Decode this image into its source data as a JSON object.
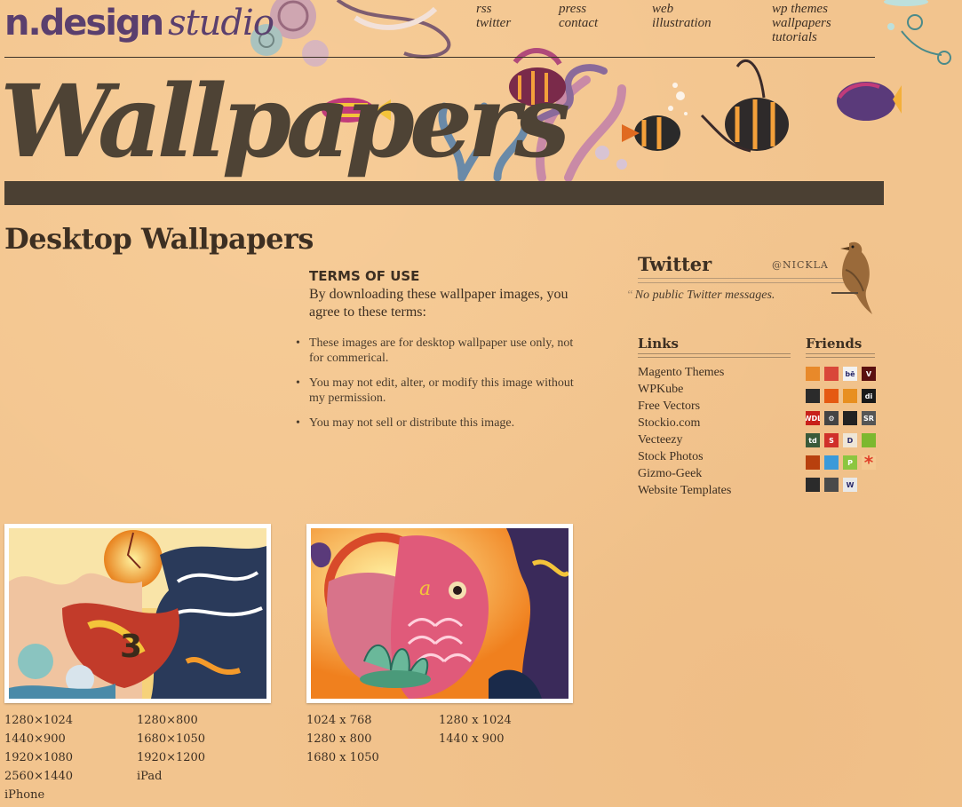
{
  "header": {
    "logo_bold": "n.design",
    "logo_italic": "studio",
    "nav": [
      [
        "rss",
        "twitter"
      ],
      [
        "press",
        "contact"
      ],
      [
        "web",
        "illustration"
      ],
      [
        "wp themes",
        "wallpapers",
        "tutorials"
      ]
    ],
    "banner_title": "Wallpapers"
  },
  "page_title": "Desktop Wallpapers",
  "terms": {
    "heading": "TERMS OF USE",
    "intro": "By downloading these wallpaper images, you agree to these terms:",
    "items": [
      "These images are for desktop wallpaper use only, not for commerical.",
      "You may not edit, alter, or modify this image without my permission.",
      "You may not sell or distribute this image."
    ]
  },
  "twitter": {
    "title": "Twitter",
    "handle": "@NICKLA",
    "message": "No public Twitter messages."
  },
  "links": {
    "title": "Links",
    "items": [
      "Magento Themes",
      "WPKube",
      "Free Vectors",
      "Stockio.com",
      "Vecteezy",
      "Stock Photos",
      "Gizmo-Geek",
      "Website Templates"
    ]
  },
  "friends": {
    "title": "Friends",
    "icons": [
      [
        {
          "t": "",
          "c": "#e8892a"
        },
        {
          "t": "",
          "c": "#d9473a"
        },
        {
          "t": "bē",
          "c": "#f2f2f2"
        },
        {
          "t": "V",
          "c": "#5a1010"
        }
      ],
      [
        {
          "t": "",
          "c": "#2b2b2b"
        },
        {
          "t": "",
          "c": "#e55a12"
        },
        {
          "t": "",
          "c": "#e88f20"
        },
        {
          "t": "di",
          "c": "#1a1a1a"
        }
      ],
      [
        {
          "t": "WDL",
          "c": "#c8201a"
        },
        {
          "t": "⚙",
          "c": "#444444"
        },
        {
          "t": "",
          "c": "#222222"
        },
        {
          "t": "SR",
          "c": "#555555"
        }
      ],
      [
        {
          "t": "td",
          "c": "#3a5a3a"
        },
        {
          "t": "S",
          "c": "#d0302a"
        },
        {
          "t": "D",
          "c": "#efe6d6"
        },
        {
          "t": "",
          "c": "#7cb82f"
        }
      ],
      [
        {
          "t": "",
          "c": "#b8400e"
        },
        {
          "t": "",
          "c": "#3a9ad9"
        },
        {
          "t": "P",
          "c": "#8cc63f"
        },
        {
          "t": "*",
          "c": "#f4c891"
        }
      ],
      [
        {
          "t": "",
          "c": "#2b2b2b"
        },
        {
          "t": "",
          "c": "#4a4a4a"
        },
        {
          "t": "W",
          "c": "#e8e8e8"
        }
      ]
    ]
  },
  "wallpapers": [
    {
      "name": "wave-wallpaper",
      "col1": [
        "1280×1024",
        "1440×900",
        "1920×1080",
        "2560×1440",
        "iPhone"
      ],
      "col2": [
        "1280×800",
        "1680×1050",
        "1920×1200",
        "iPad"
      ]
    },
    {
      "name": "koi-wallpaper",
      "col1": [
        "1024 x 768",
        "1280 x 800",
        "1680 x 1050"
      ],
      "col2": [
        "1280 x 1024",
        "1440 x 900"
      ]
    }
  ]
}
